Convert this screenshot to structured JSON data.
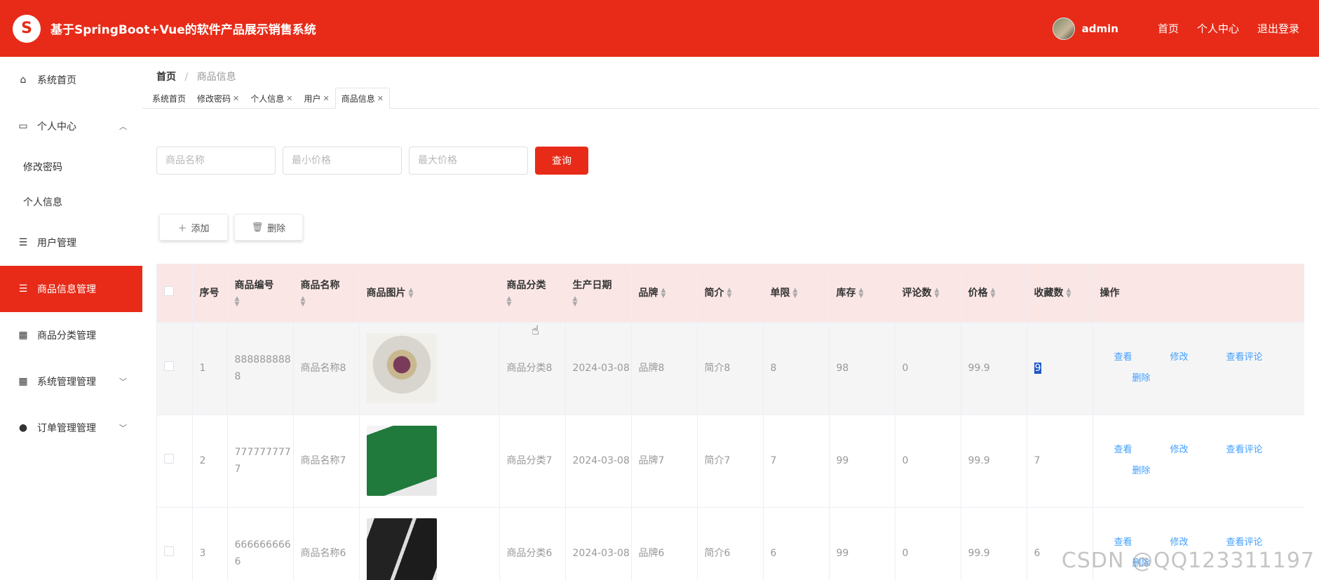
{
  "header": {
    "logo_glyph": "S",
    "title": "基于SpringBoot+Vue的软件产品展示销售系统",
    "user": "admin",
    "links": [
      "首页",
      "个人中心",
      "退出登录"
    ],
    "brand_color": "#e72b18"
  },
  "sidebar": {
    "items": [
      {
        "label": "系统首页",
        "icon": "home-icon"
      },
      {
        "label": "个人中心",
        "icon": "wallet-icon",
        "expanded": true
      },
      {
        "label": "用户管理",
        "icon": "list-icon"
      },
      {
        "label": "商品信息管理",
        "icon": "list-icon",
        "active": true
      },
      {
        "label": "商品分类管理",
        "icon": "grid-icon"
      },
      {
        "label": "系统管理管理",
        "icon": "grid-icon"
      },
      {
        "label": "订单管理管理",
        "icon": "bulb-icon"
      }
    ],
    "subitems": [
      "修改密码",
      "个人信息"
    ]
  },
  "breadcrumb": {
    "home": "首页",
    "separator": "/",
    "current": "商品信息"
  },
  "tabs": [
    {
      "label": "系统首页",
      "closable": false
    },
    {
      "label": "修改密码",
      "closable": true
    },
    {
      "label": "个人信息",
      "closable": true
    },
    {
      "label": "用户",
      "closable": true
    },
    {
      "label": "商品信息",
      "closable": true,
      "active": true
    }
  ],
  "search": {
    "name_placeholder": "商品名称",
    "min_placeholder": "最小价格",
    "max_placeholder": "最大价格",
    "query_label": "查询"
  },
  "actions": {
    "add_label": "添加",
    "delete_label": "删除"
  },
  "table": {
    "columns": [
      "序号",
      "商品编号",
      "商品名称",
      "商品图片",
      "商品分类",
      "生产日期",
      "品牌",
      "简介",
      "单限",
      "库存",
      "评论数",
      "价格",
      "收藏数",
      "操作"
    ],
    "op_labels": {
      "view": "查看",
      "edit": "修改",
      "view_comments": "查看评论",
      "delete": "删除"
    },
    "rows": [
      {
        "index": "1",
        "code": "8888888888",
        "name": "商品名称8",
        "category": "商品分类8",
        "date": "2024-03-08",
        "brand": "品牌8",
        "intro": "简介8",
        "limit": "8",
        "stock": "98",
        "comments": "0",
        "price": "99.9",
        "favorites": "9",
        "highlighted": true
      },
      {
        "index": "2",
        "code": "7777777777",
        "name": "商品名称7",
        "category": "商品分类7",
        "date": "2024-03-08",
        "brand": "品牌7",
        "intro": "简介7",
        "limit": "7",
        "stock": "99",
        "comments": "0",
        "price": "99.9",
        "favorites": "7"
      },
      {
        "index": "3",
        "code": "6666666666",
        "name": "商品名称6",
        "category": "商品分类6",
        "date": "2024-03-08",
        "brand": "品牌6",
        "intro": "简介6",
        "limit": "6",
        "stock": "99",
        "comments": "0",
        "price": "99.9",
        "favorites": "6"
      }
    ]
  },
  "watermark": "CSDN @QQ123311197"
}
